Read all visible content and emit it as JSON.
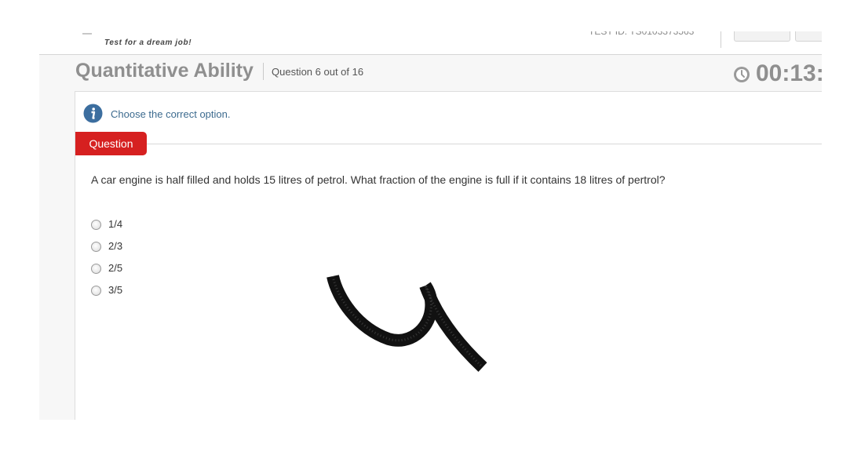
{
  "header": {
    "tagline": "Test for a dream job!",
    "test_id_label": "TEST ID: TS0103373563"
  },
  "section": {
    "title": "Quantitative Ability",
    "question_counter": "Question 6 out of 16"
  },
  "timer": {
    "display": "00:13:"
  },
  "panel": {
    "instruction": "Choose the correct option.",
    "question_tab_label": "Question",
    "question_text": "A car engine is half filled and holds 15 litres of petrol. What fraction of the engine is full if it contains 18 litres of pertrol?",
    "options": [
      {
        "label": "1/4",
        "selected": false
      },
      {
        "label": "2/3",
        "selected": false
      },
      {
        "label": "2/5",
        "selected": false
      },
      {
        "label": "3/5",
        "selected": false
      }
    ]
  },
  "annotation": {
    "drawn_number": "4"
  },
  "colors": {
    "question_tab": "#d62020",
    "instruction_text": "#3d6b8f",
    "title_gray": "#8f8f8f",
    "info_icon": "#3c6e9f"
  },
  "icons": {
    "info": "info-icon",
    "timer": "clock-icon"
  }
}
